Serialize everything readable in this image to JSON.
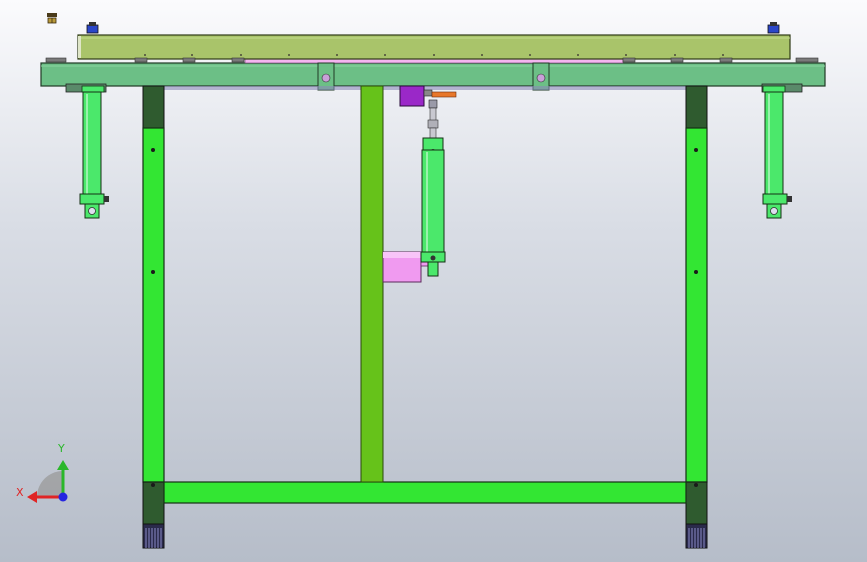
{
  "window": {
    "title": ""
  },
  "viewport": {
    "background_top": "#fbfbfd",
    "background_bottom": "#b6bdc9"
  },
  "colors": {
    "frame_green": "#33e633",
    "frame_dark": "#2f5b2f",
    "center_post": "#66c21a",
    "top_plate": "#a9c46a",
    "base_plate": "#6cbf86",
    "cylinder": "#4be86b",
    "pink_part": "#f09af0",
    "purple_block": "#9a28c8",
    "orange_fitting": "#e8772a",
    "blue_nut": "#2a46c8",
    "foot_dark": "#2a2a4a"
  },
  "triad": {
    "x_label": "X",
    "y_label": "Y",
    "x_color": "#e02424",
    "y_color": "#2ab72a",
    "z_color": "#2626e0"
  },
  "icons": {
    "top_glyph": "view-orientation-icon"
  }
}
